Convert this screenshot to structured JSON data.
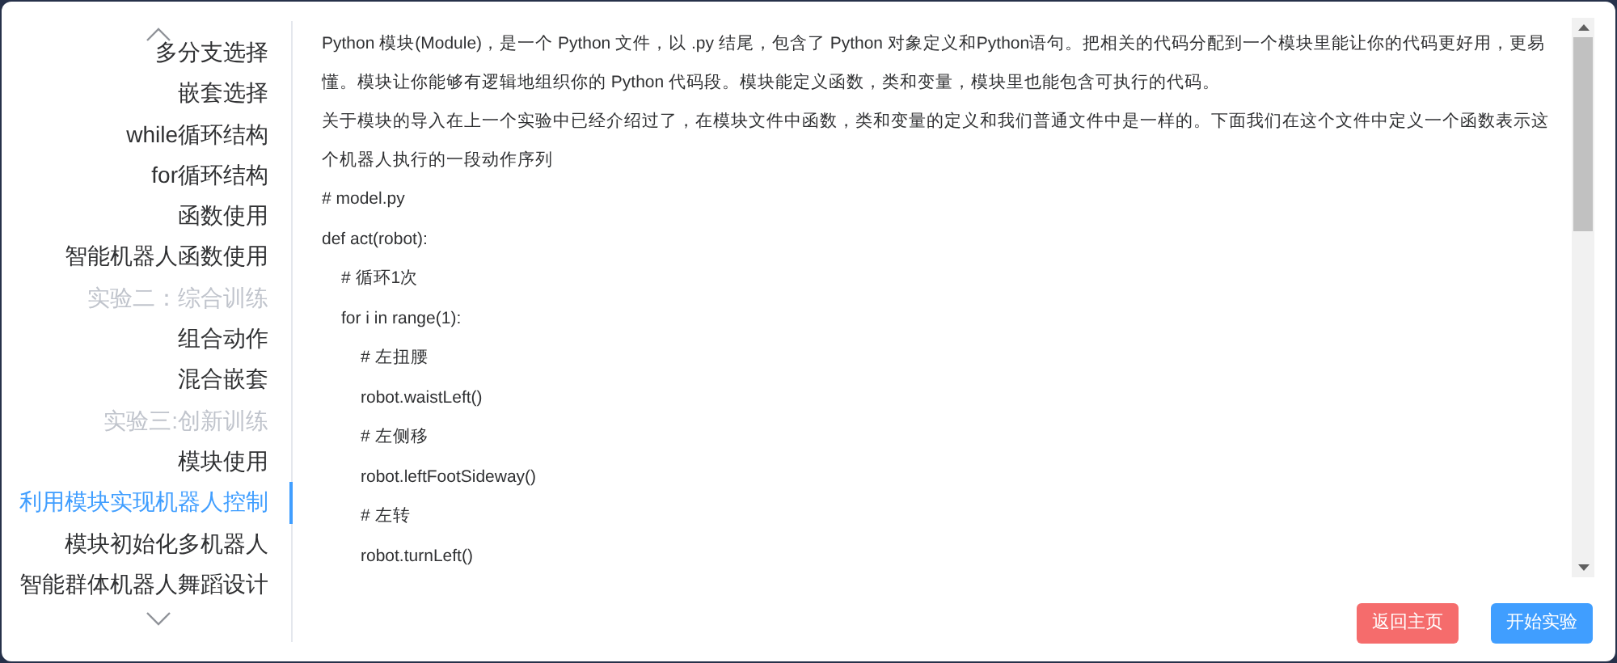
{
  "sidebar": {
    "items": [
      {
        "label": "多分支选择",
        "kind": "item",
        "selected": false
      },
      {
        "label": "嵌套选择",
        "kind": "item",
        "selected": false
      },
      {
        "label": "while循环结构",
        "kind": "item",
        "selected": false
      },
      {
        "label": "for循环结构",
        "kind": "item",
        "selected": false
      },
      {
        "label": "函数使用",
        "kind": "item",
        "selected": false
      },
      {
        "label": "智能机器人函数使用",
        "kind": "item",
        "selected": false
      },
      {
        "label": "实验二：综合训练",
        "kind": "heading",
        "selected": false
      },
      {
        "label": "组合动作",
        "kind": "item",
        "selected": false
      },
      {
        "label": "混合嵌套",
        "kind": "item",
        "selected": false
      },
      {
        "label": "实验三:创新训练",
        "kind": "heading",
        "selected": false
      },
      {
        "label": "模块使用",
        "kind": "item",
        "selected": false
      },
      {
        "label": "利用模块实现机器人控制",
        "kind": "item",
        "selected": true
      },
      {
        "label": "模块初始化多机器人",
        "kind": "item",
        "selected": false
      },
      {
        "label": "智能群体机器人舞蹈设计",
        "kind": "item",
        "selected": false
      }
    ]
  },
  "content": {
    "paragraphs": [
      "Python 模块(Module)，是一个 Python 文件，以 .py 结尾，包含了 Python 对象定义和Python语句。把相关的代码分配到一个模块里能让你的代码更好用，更易懂。模块让你能够有逻辑地组织你的 Python 代码段。模块能定义函数，类和变量，模块里也能包含可执行的代码。",
      "关于模块的导入在上一个实验中已经介绍过了，在模块文件中函数，类和变量的定义和我们普通文件中是一样的。下面我们在这个文件中定义一个函数表示这个机器人执行的一段动作序列"
    ],
    "code": [
      {
        "text": "# model.py"
      },
      {
        "text": "def act(robot):",
        "children": [
          {
            "text": "# 循环1次"
          },
          {
            "text": "for i in range(1):",
            "children": [
              {
                "text": "# 左扭腰"
              },
              {
                "text": "robot.waistLeft()"
              },
              {
                "text": "# 左侧移"
              },
              {
                "text": "robot.leftFootSideway()"
              },
              {
                "text": "# 左转"
              },
              {
                "text": "robot.turnLeft()"
              }
            ]
          }
        ]
      }
    ]
  },
  "buttons": [
    {
      "label": "返回主页",
      "kind": "danger"
    },
    {
      "label": "开始实验",
      "kind": "primary"
    }
  ]
}
